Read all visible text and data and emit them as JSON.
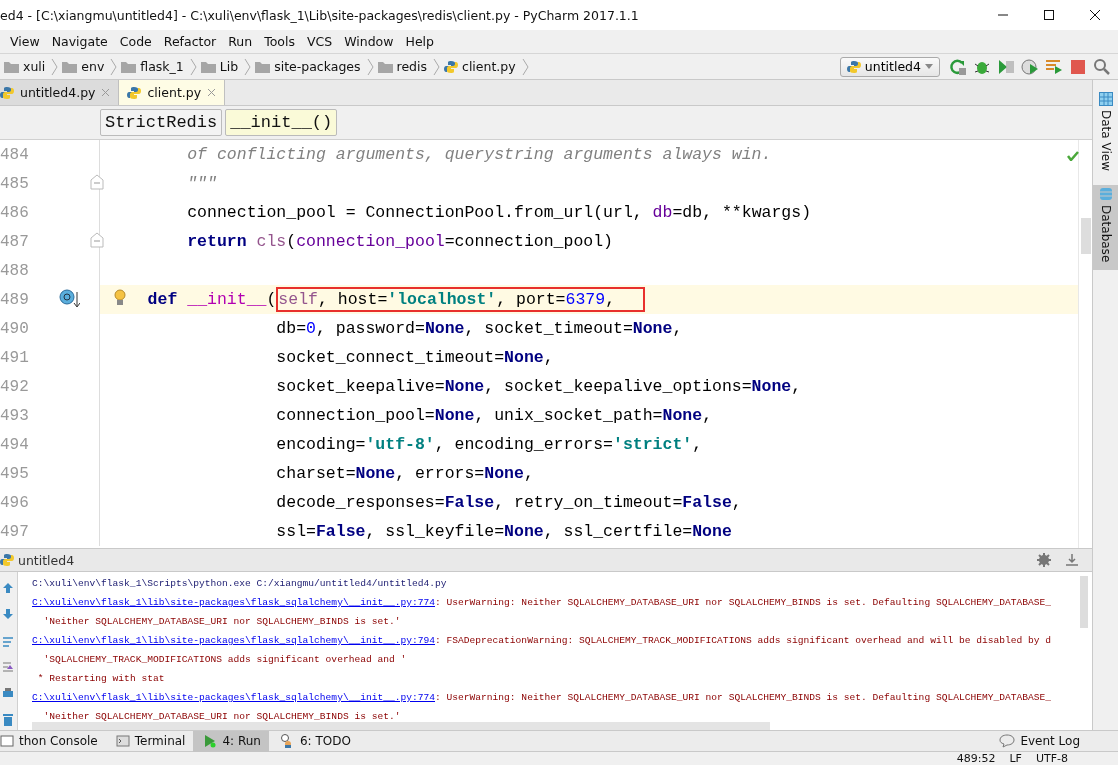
{
  "window": {
    "title": "ed4 - [C:\\xiangmu\\untitled4] - C:\\xuli\\env\\flask_1\\Lib\\site-packages\\redis\\client.py - PyCharm 2017.1.1"
  },
  "menu": [
    "View",
    "Navigate",
    "Code",
    "Refactor",
    "Run",
    "Tools",
    "VCS",
    "Window",
    "Help"
  ],
  "navigation": {
    "crumbs": [
      {
        "label": "xuli",
        "kind": "folder"
      },
      {
        "label": "env",
        "kind": "folder"
      },
      {
        "label": "flask_1",
        "kind": "folder"
      },
      {
        "label": "Lib",
        "kind": "folder"
      },
      {
        "label": "site-packages",
        "kind": "folder"
      },
      {
        "label": "redis",
        "kind": "folder"
      },
      {
        "label": "client.py",
        "kind": "python"
      }
    ],
    "run_config": "untitled4"
  },
  "editor_tabs": [
    {
      "label": "untitled4.py",
      "selected": false
    },
    {
      "label": "client.py",
      "selected": true
    }
  ],
  "structure_crumbs": [
    {
      "label": "StrictRedis",
      "selected": false
    },
    {
      "label": "__init__()",
      "selected": true
    }
  ],
  "code_lines": [
    {
      "number": "484",
      "tokens": [
        {
          "t": "        of conflicting arguments, querystring arguments always win.",
          "kind": "doc"
        }
      ]
    },
    {
      "number": "485",
      "fold": true,
      "tokens": [
        {
          "t": "        \"\"\"",
          "kind": "doc"
        }
      ]
    },
    {
      "number": "486",
      "tokens": [
        {
          "t": "        connection_pool = ConnectionPool.from_url(url, ",
          "kind": "plain"
        },
        {
          "t": "db",
          "kind": "named_arg"
        },
        {
          "t": "=db, **kwargs)",
          "kind": "plain"
        }
      ]
    },
    {
      "number": "487",
      "fold": true,
      "tokens": [
        {
          "t": "        return",
          "kind": "keyword"
        },
        {
          "t": " cls",
          "kind": "self"
        },
        {
          "t": "(",
          "kind": "plain"
        },
        {
          "t": "connection_pool",
          "kind": "named_arg"
        },
        {
          "t": "=connection_pool)",
          "kind": "plain"
        }
      ]
    },
    {
      "number": "488"
    },
    {
      "number": "489",
      "current": true,
      "override": true,
      "bulb": true,
      "tokens": [
        {
          "t": "    def",
          "kind": "keyword"
        },
        {
          "t": " __init__",
          "kind": "magic"
        },
        {
          "t": "(",
          "kind": "plain"
        }
      ],
      "boxed_tokens": [
        {
          "t": "self",
          "kind": "self"
        },
        {
          "t": ", host=",
          "kind": "plain"
        },
        {
          "t": "'localhost'",
          "kind": "string"
        },
        {
          "t": ", port=",
          "kind": "plain"
        },
        {
          "t": "6379",
          "kind": "number"
        },
        {
          "t": ",",
          "kind": "plain"
        }
      ]
    },
    {
      "number": "490",
      "tokens": [
        {
          "t": "                 db=",
          "kind": "plain"
        },
        {
          "t": "0",
          "kind": "number"
        },
        {
          "t": ", password=",
          "kind": "plain"
        },
        {
          "t": "None",
          "kind": "keyword"
        },
        {
          "t": ", socket_timeout=",
          "kind": "plain"
        },
        {
          "t": "None",
          "kind": "keyword"
        },
        {
          "t": ",",
          "kind": "plain"
        }
      ]
    },
    {
      "number": "491",
      "tokens": [
        {
          "t": "                 socket_connect_timeout=",
          "kind": "plain"
        },
        {
          "t": "None",
          "kind": "keyword"
        },
        {
          "t": ",",
          "kind": "plain"
        }
      ]
    },
    {
      "number": "492",
      "tokens": [
        {
          "t": "                 socket_keepalive=",
          "kind": "plain"
        },
        {
          "t": "None",
          "kind": "keyword"
        },
        {
          "t": ", socket_keepalive_options=",
          "kind": "plain"
        },
        {
          "t": "None",
          "kind": "keyword"
        },
        {
          "t": ",",
          "kind": "plain"
        }
      ]
    },
    {
      "number": "493",
      "tokens": [
        {
          "t": "                 connection_pool=",
          "kind": "plain"
        },
        {
          "t": "None",
          "kind": "keyword"
        },
        {
          "t": ", unix_socket_path=",
          "kind": "plain"
        },
        {
          "t": "None",
          "kind": "keyword"
        },
        {
          "t": ",",
          "kind": "plain"
        }
      ]
    },
    {
      "number": "494",
      "tokens": [
        {
          "t": "                 encoding=",
          "kind": "plain"
        },
        {
          "t": "'utf-8'",
          "kind": "string"
        },
        {
          "t": ", encoding_errors=",
          "kind": "plain"
        },
        {
          "t": "'strict'",
          "kind": "string"
        },
        {
          "t": ",",
          "kind": "plain"
        }
      ]
    },
    {
      "number": "495",
      "tokens": [
        {
          "t": "                 charset=",
          "kind": "plain"
        },
        {
          "t": "None",
          "kind": "keyword"
        },
        {
          "t": ", errors=",
          "kind": "plain"
        },
        {
          "t": "None",
          "kind": "keyword"
        },
        {
          "t": ",",
          "kind": "plain"
        }
      ]
    },
    {
      "number": "496",
      "tokens": [
        {
          "t": "                 decode_responses=",
          "kind": "plain"
        },
        {
          "t": "False",
          "kind": "keyword"
        },
        {
          "t": ", retry_on_timeout=",
          "kind": "plain"
        },
        {
          "t": "False",
          "kind": "keyword"
        },
        {
          "t": ",",
          "kind": "plain"
        }
      ]
    },
    {
      "number": "497",
      "tokens": [
        {
          "t": "                 ssl=",
          "kind": "plain"
        },
        {
          "t": "False",
          "kind": "keyword"
        },
        {
          "t": ", ssl_keyfile=",
          "kind": "plain"
        },
        {
          "t": "None",
          "kind": "keyword"
        },
        {
          "t": ", ssl_certfile=",
          "kind": "plain"
        },
        {
          "t": "None",
          "kind": "keyword"
        }
      ]
    }
  ],
  "run_panel": {
    "title": "untitled4",
    "lines": [
      {
        "kind": "command",
        "text": "C:\\xuli\\env\\flask_1\\Scripts\\python.exe C:/xiangmu/untitled4/untitled4.py"
      },
      {
        "kind": "warning",
        "link": "C:\\xuli\\env\\flask_1\\lib\\site-packages\\flask_sqlalchemy\\__init__.py:774",
        "text": ": UserWarning: Neither SQLALCHEMY_DATABASE_URI nor SQLALCHEMY_BINDS is set. Defaulting SQLALCHEMY_DATABASE_"
      },
      {
        "kind": "error",
        "text": "  'Neither SQLALCHEMY_DATABASE_URI nor SQLALCHEMY_BINDS is set.'"
      },
      {
        "kind": "warning",
        "link": "C:\\xuli\\env\\flask_1\\lib\\site-packages\\flask_sqlalchemy\\__init__.py:794",
        "text": ": FSADeprecationWarning: SQLALCHEMY_TRACK_MODIFICATIONS adds significant overhead and will be disabled by d"
      },
      {
        "kind": "error",
        "text": "  'SQLALCHEMY_TRACK_MODIFICATIONS adds significant overhead and '"
      },
      {
        "kind": "error",
        "text": " * Restarting with stat"
      },
      {
        "kind": "warning",
        "link": "C:\\xuli\\env\\flask_1\\lib\\site-packages\\flask_sqlalchemy\\__init__.py:774",
        "text": ": UserWarning: Neither SQLALCHEMY_DATABASE_URI nor SQLALCHEMY_BINDS is set. Defaulting SQLALCHEMY_DATABASE_"
      },
      {
        "kind": "error",
        "text": "  'Neither SQLALCHEMY_DATABASE_URI nor SQLALCHEMY_BINDS is set.'"
      }
    ]
  },
  "side_tabs": [
    {
      "label": "Data View",
      "kind": "grid",
      "selected": false
    },
    {
      "label": "Database",
      "kind": "database",
      "selected": true
    }
  ],
  "tool_tabs": [
    {
      "label": "thon Console",
      "kind": "console",
      "selected": false
    },
    {
      "label": "Terminal",
      "kind": "terminal",
      "selected": false
    },
    {
      "label": "4: Run",
      "kind": "run",
      "selected": true
    },
    {
      "label": "6: TODO",
      "kind": "todo",
      "selected": false
    }
  ],
  "event_log": "Event Log",
  "status_bar": {
    "position": "489:52",
    "line_separator": "LF",
    "encoding": "UTF-8"
  }
}
